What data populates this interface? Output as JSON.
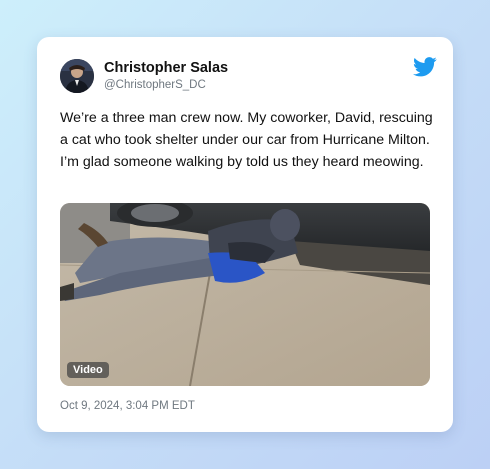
{
  "tweet": {
    "author_name": "Christopher Salas",
    "author_handle": "@ChristopherS_DC",
    "text": "We’re a three man crew now. My coworker, David, rescuing a cat who took shelter under our car from Hurricane Milton. I’m glad someone walking by told us they heard meowing.",
    "media_badge": "Video",
    "timestamp": "Oct 9, 2024, 3:04 PM EDT"
  },
  "icons": {
    "platform_logo": "twitter-bird-icon",
    "avatar": "avatar"
  },
  "colors": {
    "twitter_blue": "#1d9bf0",
    "text_primary": "#111111",
    "text_secondary": "#6f7880"
  }
}
